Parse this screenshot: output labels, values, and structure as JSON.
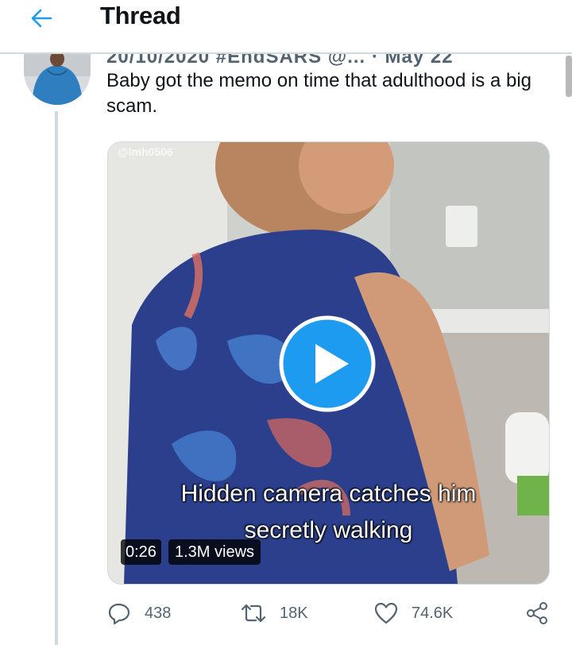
{
  "header": {
    "title": "Thread",
    "back_icon": "arrow-left-icon"
  },
  "colors": {
    "accent": "#1d9bf0",
    "secondary_text": "#536471",
    "divider": "#cfd9de"
  },
  "tweet": {
    "meta_clipped": "20/10/2020 #EndSARS @...  · May 22",
    "text": "Baby got the memo on time that adulthood is a big scam.",
    "media": {
      "watermark": "@lmh0506",
      "caption_line1": "Hidden camera catches him",
      "caption_line2": "secretly walking",
      "duration": "0:26",
      "views": "1.3M views"
    },
    "actions": {
      "replies": "438",
      "retweets": "18K",
      "likes": "74.6K"
    }
  }
}
